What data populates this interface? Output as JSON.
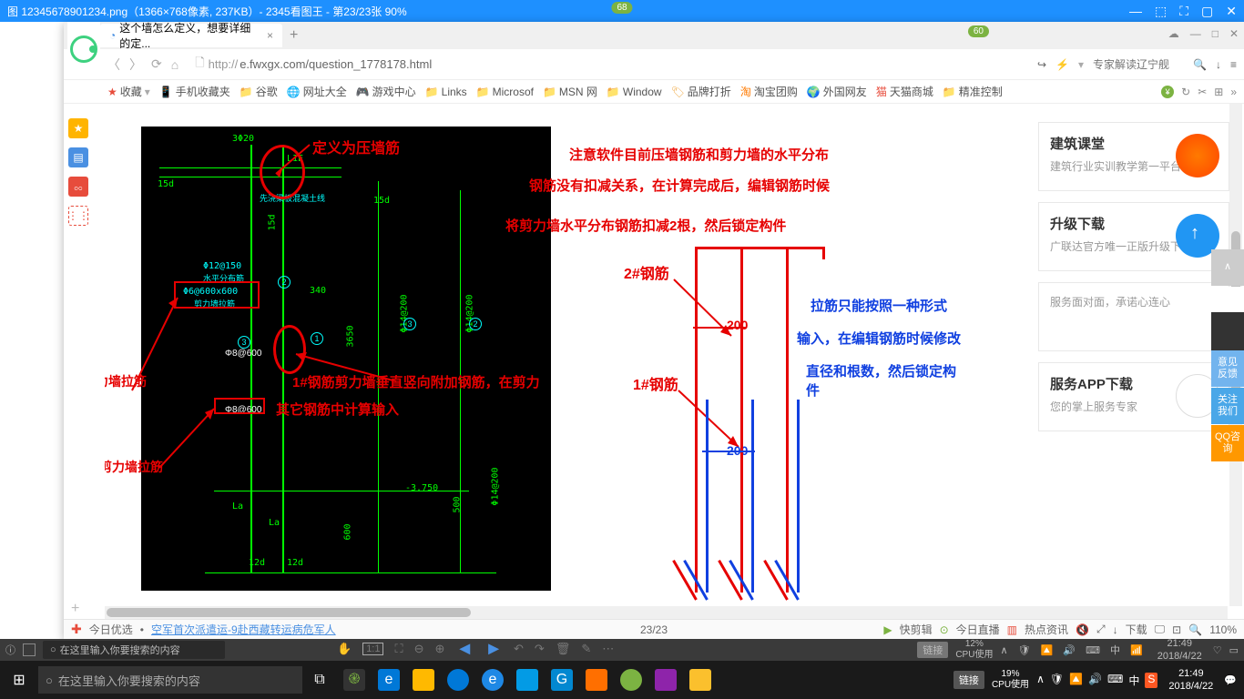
{
  "viewer": {
    "title": "图 12345678901234.png（1366×768像素, 237KB）- 2345看图王 - 第23/23张 90%",
    "badge": "68",
    "counter": "23/23",
    "zoom_readout": "110%"
  },
  "browser": {
    "badge": "60",
    "tab_title": "这个墙怎么定义，想要详细的定...",
    "url_proto": "http://",
    "url": "e.fwxgx.com/question_1778178.html",
    "search_placeholder": "专家解读辽宁舰"
  },
  "bookmarks": {
    "fav": "收藏",
    "items": [
      "手机收藏夹",
      "谷歌",
      "网址大全",
      "游戏中心",
      "Links",
      "Microsof",
      "MSN 网",
      "Window",
      "品牌打折",
      "淘宝团购",
      "外国网友",
      "天猫商城",
      "精准控制"
    ]
  },
  "bottombar": {
    "today": "今日优选",
    "news": "空军首次派遣运-9赴西藏转运病危军人",
    "clip": "快剪辑",
    "live": "今日直播",
    "hot": "热点资讯",
    "mute_icon": "🔇",
    "down_icon": "↓",
    "download": "下载",
    "pip_icon": "🖵",
    "maglabel": "🔍"
  },
  "annotations": {
    "a1": "定义为压墙筋",
    "a2": "注意软件目前压墙钢筋和剪力墙的水平分布",
    "a3": "钢筋没有扣减关系，在计算完成后，编辑钢筋时候",
    "a4": "将剪力墙水平分布钢筋扣减2根，然后锁定构件",
    "a5": "2#钢筋",
    "a6": "1#钢筋",
    "a7": "200",
    "a8": "200",
    "a9": "1#钢筋剪力墙垂直竖向附加钢筋，在剪力",
    "a10": "其它钢筋中计算输入",
    "a11": "剪力墙拉筋",
    "a12": "剪力墙拉筋",
    "b1": "拉筋只能按照一种形式",
    "b2": "输入，在编辑钢筋时候修改",
    "b3": "直径和根数，然后锁定构件"
  },
  "cad": {
    "t3_20": "3Φ20",
    "l1e": "L1E",
    "d15_a": "15d",
    "d15_b": "15d",
    "d15_c": "15d",
    "phi12": "Φ12@150",
    "hpfb": "水平分布筋",
    "phi6": "Φ6@600x600",
    "slcfb": "剪力墙拉筋",
    "n340": "340",
    "h3650": "3650",
    "h600": "600",
    "h500": "500",
    "phi14_200a": "Φ14@200",
    "phi14_200b": "Φ14@200",
    "phi14_200c": "Φ14@200",
    "m3": "3",
    "m2": "2",
    "c1": "1",
    "c2": "2",
    "c3": "3",
    "phi8_600a": "Φ8@600",
    "phi8_600b": "Φ8@600",
    "la1": "La",
    "la2": "La",
    "d12a": "12d",
    "d12b": "12d",
    "lev": "-3.750",
    "beam": "先浇梁板混凝土线"
  },
  "cards": {
    "c1_title": "建筑课堂",
    "c1_sub": "建筑行业实训教学第一平台",
    "c2_title": "升级下载",
    "c2_sub": "广联达官方唯一正版升级下载",
    "c3_title": "",
    "c3_sub": "服务面对面，承诺心连心",
    "c4_title": "服务APP下载",
    "c4_sub": "您的掌上服务专家"
  },
  "float": {
    "top": "∧",
    "feedback": "意见反馈",
    "follow": "关注我们",
    "qq": "QQ咨询"
  },
  "alt_taskbar": {
    "info": "ⓘ",
    "search": "在这里输入你要搜索的内容",
    "link": "链接",
    "cpu": "12%",
    "cpu_label": "CPU使用",
    "time": "21:49",
    "date": "2018/4/22"
  },
  "taskbar": {
    "search": "在这里输入你要搜索的内容",
    "link": "链接",
    "cpu": "19%",
    "cpu_label": "CPU使用",
    "ime": "中",
    "time": "21:49",
    "date": "2018/4/22"
  }
}
